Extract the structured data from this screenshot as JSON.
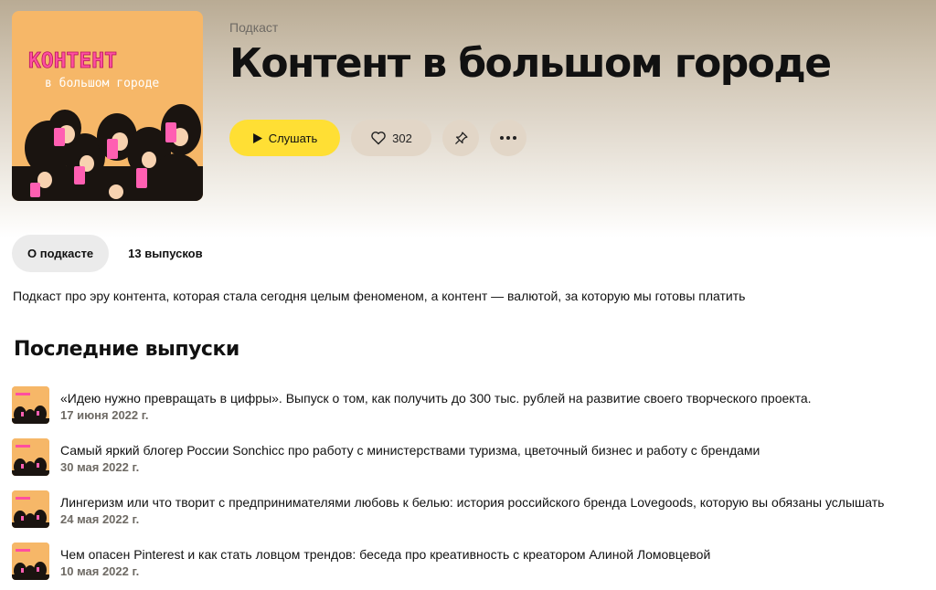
{
  "podcast": {
    "kicker": "Подкаст",
    "title": "Контент в большом городе",
    "cover": {
      "line1": "КОНТЕНТ",
      "line2": "в большом городе",
      "bg_color": "#f6b768",
      "accent_color": "#ff4fa0"
    }
  },
  "actions": {
    "play_label": "Слушать",
    "like_count": "302",
    "play_icon": "play-icon",
    "like_icon": "heart-icon",
    "pin_icon": "pin-icon",
    "more_icon": "more-icon"
  },
  "tabs": [
    {
      "label": "О подкасте",
      "active": true
    },
    {
      "label": "13 выпусков",
      "active": false
    }
  ],
  "description": "Подкаст про эру контента, которая стала сегодня целым феноменом, а контент — валютой, за которую мы готовы платить",
  "latest": {
    "title": "Последние выпуски",
    "episodes": [
      {
        "title": "«Идею нужно превращать в цифры». Выпуск о том, как получить до 300 тыс. рублей на развитие своего творческого проекта.",
        "date": "17 июня 2022 г."
      },
      {
        "title": "Самый яркий блогер России Sonchicc про работу с министерствами туризма, цветочный бизнес и работу с брендами",
        "date": "30 мая 2022 г."
      },
      {
        "title": "Лингеризм или что творит с предпринимателями любовь к белью: история российского бренда Lovegoods, которую вы обязаны услышать",
        "date": "24 мая 2022 г."
      },
      {
        "title": "Чем опасен Pinterest и как стать ловцом трендов: беседа про креативность с креатором Алиной Ломовцевой",
        "date": "10 мая 2022 г."
      }
    ]
  },
  "colors": {
    "play_button": "#ffdf34",
    "secondary_button": "#e2d6c7",
    "active_tab": "#ebebeb"
  }
}
